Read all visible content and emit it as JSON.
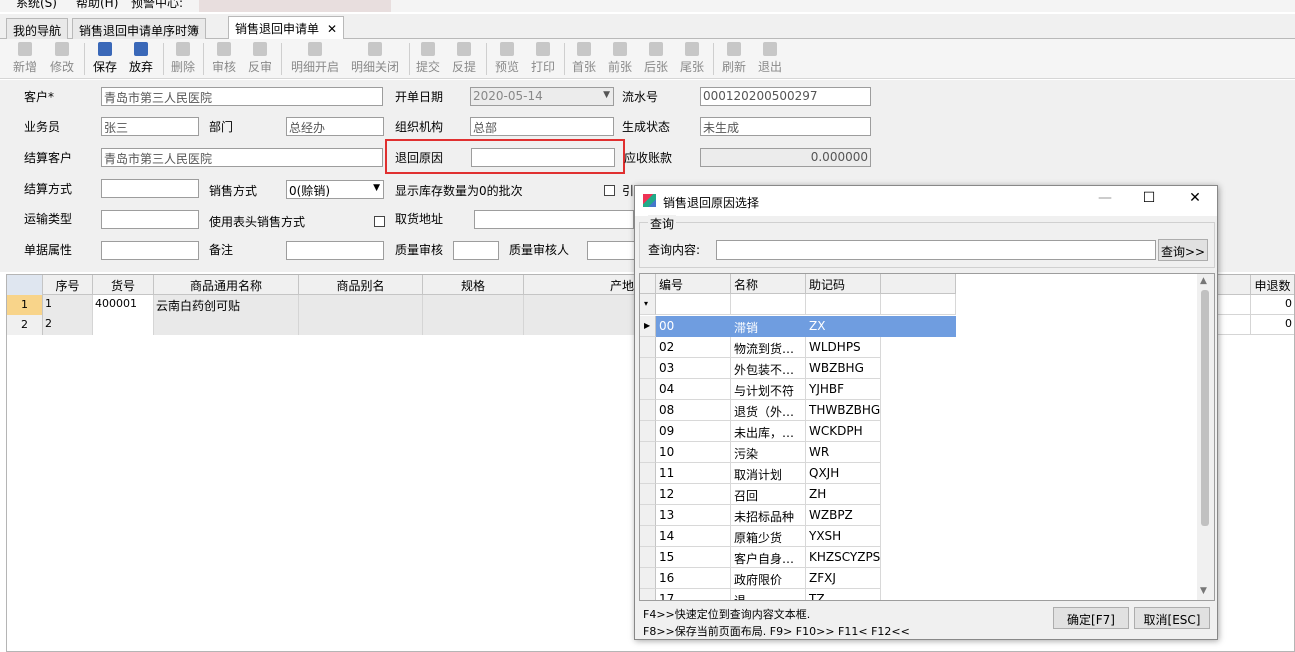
{
  "menubar": {
    "items": [
      "系统(S)",
      "帮助(H)",
      "预警中心:"
    ]
  },
  "tabs": [
    {
      "label": "我的导航"
    },
    {
      "label": "销售退回申请单序时簿"
    },
    {
      "label": "销售退回申请单",
      "close": "✕"
    }
  ],
  "toolbar": {
    "buttons": [
      "新增",
      "修改",
      "保存",
      "放弃",
      "删除",
      "审核",
      "反审",
      "明细开启",
      "明细关闭",
      "提交",
      "反提",
      "预览",
      "打印",
      "首张",
      "前张",
      "后张",
      "尾张",
      "刷新",
      "退出"
    ]
  },
  "form": {
    "customer": {
      "label": "客户*",
      "value": "青岛市第三人民医院"
    },
    "open_date": {
      "label": "开单日期",
      "value": "2020-05-14"
    },
    "serial_no": {
      "label": "流水号",
      "value": "000120200500297"
    },
    "salesman": {
      "label": "业务员",
      "value": "张三"
    },
    "department": {
      "label": "部门",
      "value": "总经办"
    },
    "org": {
      "label": "组织机构",
      "value": "总部"
    },
    "gen_status": {
      "label": "生成状态",
      "value": "未生成"
    },
    "settle_customer": {
      "label": "结算客户",
      "value": "青岛市第三人民医院"
    },
    "return_reason": {
      "label": "退回原因",
      "value": ""
    },
    "receivable": {
      "label": "应收账款",
      "value": "0.000000"
    },
    "settle_method": {
      "label": "结算方式",
      "value": ""
    },
    "sales_method": {
      "label": "销售方式",
      "value": "0(赊销)"
    },
    "show_zero_stock": {
      "label": "显示库存数量为0的批次"
    },
    "extra_checkbox": {
      "label": "引"
    },
    "transport_type": {
      "label": "运输类型",
      "value": ""
    },
    "use_header_method": {
      "label": "使用表头销售方式"
    },
    "pickup_address": {
      "label": "取货地址",
      "value": ""
    },
    "doc_attr": {
      "label": "单据属性",
      "value": ""
    },
    "remark": {
      "label": "备注",
      "value": ""
    },
    "quality_audit": {
      "label": "质量审核",
      "value": ""
    },
    "quality_auditor": {
      "label": "质量审核人",
      "value": ""
    }
  },
  "grid": {
    "columns": [
      "序号",
      "货号",
      "商品通用名称",
      "商品别名",
      "规格",
      "产地"
    ],
    "right_column": "申退数",
    "rows": [
      {
        "row": "1",
        "seq": "1",
        "code": "400001",
        "name": "云南白药创可贴",
        "alias": "",
        "spec": "",
        "origin": "",
        "qty": "0"
      },
      {
        "row": "2",
        "seq": "2",
        "code": "",
        "name": "",
        "alias": "",
        "spec": "",
        "origin": "",
        "qty": "0"
      }
    ]
  },
  "dialog": {
    "title": "销售退回原因选择",
    "minimize": "—",
    "maximize": "☐",
    "close": "✕",
    "group_label": "查询",
    "query_label": "查询内容:",
    "query_value": "",
    "query_button": "查询>>",
    "columns": [
      "编号",
      "名称",
      "助记码"
    ],
    "rows": [
      {
        "id": "00",
        "name": "滞销",
        "code": "ZX"
      },
      {
        "id": "02",
        "name": "物流到货…",
        "code": "WLDHPS"
      },
      {
        "id": "03",
        "name": "外包装不…",
        "code": "WBZBHG"
      },
      {
        "id": "04",
        "name": "与计划不符",
        "code": "YJHBF"
      },
      {
        "id": "08",
        "name": "退货（外…",
        "code": "THWBZBHG"
      },
      {
        "id": "09",
        "name": "未出库，…",
        "code": "WCKDPH"
      },
      {
        "id": "10",
        "name": "污染",
        "code": "WR"
      },
      {
        "id": "11",
        "name": "取消计划",
        "code": "QXJH"
      },
      {
        "id": "12",
        "name": "召回",
        "code": "ZH"
      },
      {
        "id": "13",
        "name": "未招标品种",
        "code": "WZBPZ"
      },
      {
        "id": "14",
        "name": "原箱少货",
        "code": "YXSH"
      },
      {
        "id": "15",
        "name": "客户自身…",
        "code": "KHZSCYZPS"
      },
      {
        "id": "16",
        "name": "政府限价",
        "code": "ZFXJ"
      },
      {
        "id": "17",
        "name": "退…",
        "code": "TZ"
      }
    ],
    "hint1": "F4>>快速定位到查询内容文本框.",
    "hint2": "F8>>保存当前页面布局.  F9> F10>> F11< F12<<",
    "ok_button": "确定[F7]",
    "cancel_button": "取消[ESC]"
  }
}
